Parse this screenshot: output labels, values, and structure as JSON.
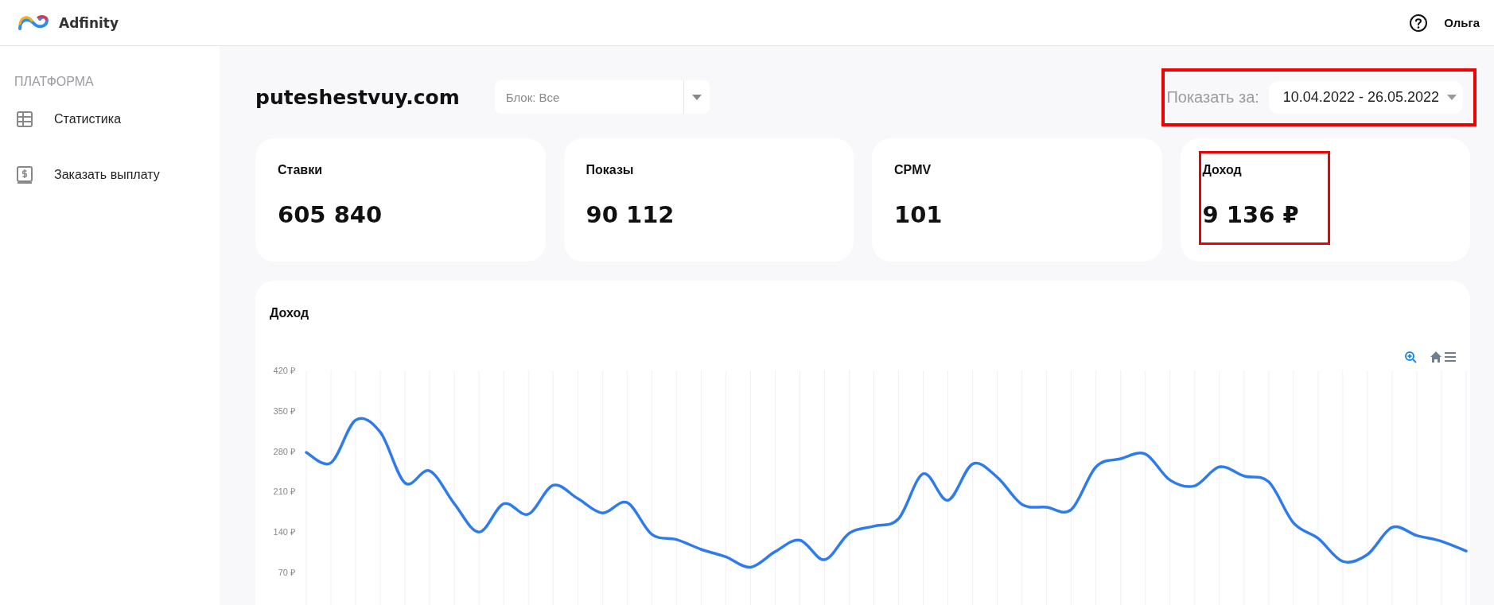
{
  "header": {
    "logo_text": "Adfinity",
    "user_name": "Ольга"
  },
  "sidebar": {
    "section_title": "ПЛАТФОРМА",
    "items": [
      {
        "label": "Статистика",
        "kind": "table"
      },
      {
        "label": "Заказать выплату",
        "kind": "payout"
      }
    ]
  },
  "page": {
    "title": "puteshestvuy.com",
    "block_filter": {
      "value": "Блок: Все"
    },
    "date_range": {
      "label": "Показать за:",
      "value": "10.04.2022 - 26.05.2022",
      "highlighted": true
    }
  },
  "cards": [
    {
      "label": "Ставки",
      "value": "605 840",
      "highlighted": false
    },
    {
      "label": "Показы",
      "value": "90 112",
      "highlighted": false
    },
    {
      "label": "CPMV",
      "value": "101",
      "highlighted": false
    },
    {
      "label": "Доход",
      "value": "9 136 ₽",
      "highlighted": true
    }
  ],
  "chart": {
    "title": "Доход",
    "chart_data": {
      "type": "line",
      "grid": true,
      "ylim": [
        70,
        420
      ],
      "yticks": [
        {
          "value": 70,
          "label": "70 ₽"
        },
        {
          "value": 140,
          "label": "140 ₽"
        },
        {
          "value": 210,
          "label": "210 ₽"
        },
        {
          "value": 280,
          "label": "280 ₽"
        },
        {
          "value": 350,
          "label": "350 ₽"
        },
        {
          "value": 420,
          "label": "420 ₽"
        }
      ],
      "series": [
        {
          "color": "#2e7bf0",
          "values": [
            278,
            260,
            334,
            313,
            225,
            246,
            189,
            140,
            189,
            171,
            221,
            198,
            173,
            191,
            136,
            127,
            110,
            97,
            79,
            106,
            126,
            92,
            138,
            150,
            163,
            241,
            195,
            258,
            235,
            188,
            183,
            179,
            253,
            267,
            275,
            230,
            220,
            253,
            237,
            227,
            156,
            129,
            89,
            101,
            148,
            134,
            124,
            107
          ]
        }
      ]
    }
  }
}
